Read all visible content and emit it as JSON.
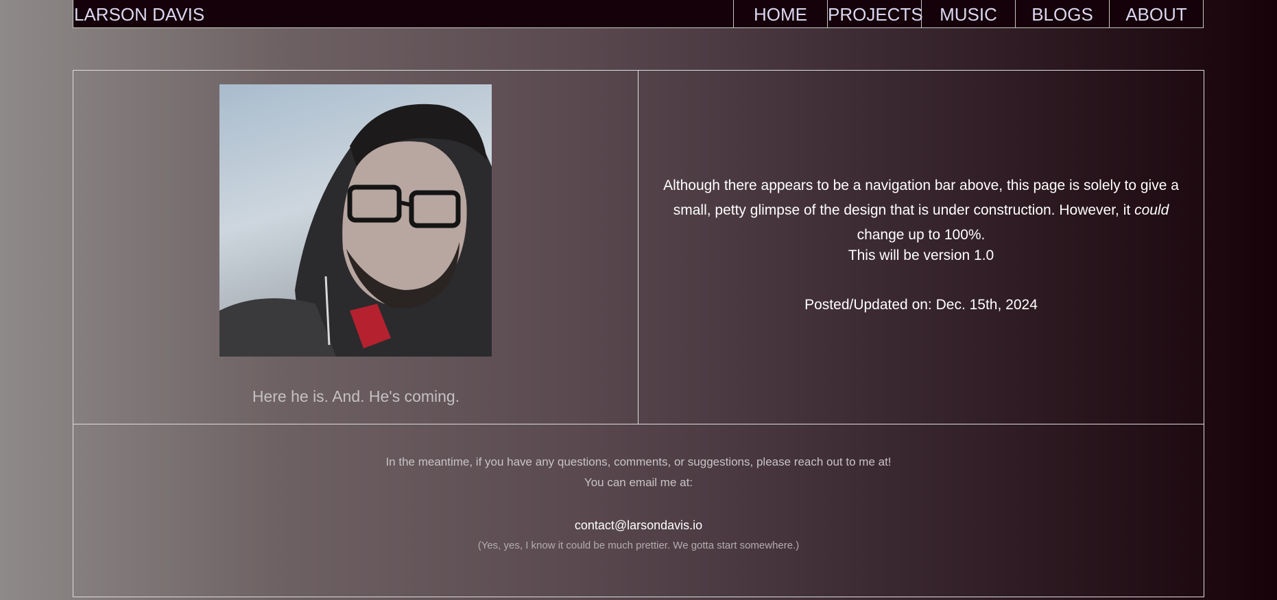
{
  "header": {
    "brand": "LARSON DAVIS",
    "nav": [
      {
        "label": "HOME"
      },
      {
        "label": "PROJECTS"
      },
      {
        "label": "MUSIC"
      },
      {
        "label": "BLOGS"
      },
      {
        "label": "ABOUT"
      }
    ]
  },
  "main": {
    "photo_caption": "Here he is. And. He's coming.",
    "intro_before": "Although there appears to be a navigation bar above, this page is solely to give a small, petty glimpse of the design that is under construction. However, it ",
    "intro_emphasis": "could",
    "intro_after": " change up to 100%.",
    "version_line": "This will be version 1.0",
    "posted_line": "Posted/Updated on: Dec. 15th, 2024"
  },
  "footer": {
    "line1": "In the meantime, if you have any questions, comments, or suggestions, please reach out to me at!",
    "line2": "You can email me at:",
    "email": "contact@larsondavis.io",
    "note": "(Yes, yes, I know it could be much prettier. We gotta start somewhere.)"
  },
  "colors": {
    "nav_bg": "#150109",
    "nav_text": "#dad8f2",
    "border": "#e0dde0",
    "gradient_left": "#8e8a89",
    "gradient_right": "#170209"
  }
}
